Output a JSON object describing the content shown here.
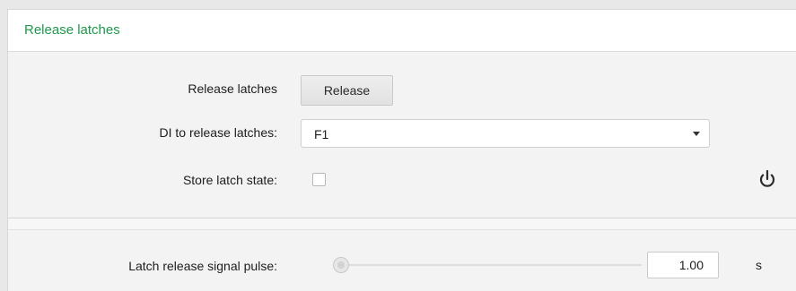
{
  "header": {
    "title": "Release latches"
  },
  "settings": {
    "release_latches_label": "Release latches",
    "release_button_label": "Release",
    "di_label": "DI to release latches:",
    "di_value": "F1",
    "store_label": "Store latch state:",
    "store_checked": false,
    "pulse_label": "Latch release signal pulse:",
    "pulse_value": "1.00",
    "pulse_unit": "s"
  },
  "icons": {
    "power": "power-icon",
    "dropdown": "chevron-down-icon"
  },
  "colors": {
    "title": "#1f9a4b",
    "panel_bg": "#f3f3f3"
  }
}
